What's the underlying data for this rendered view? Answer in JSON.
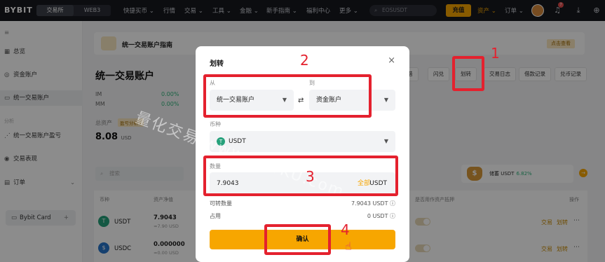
{
  "topbar": {
    "logo": "BYBIT",
    "segments": [
      "交易所",
      "WEB3"
    ],
    "nav": [
      "快捷买币 ⌄",
      "行情",
      "交易 ⌄",
      "工具 ⌄",
      "金融 ⌄",
      "新手指南 ⌄",
      "福利中心",
      "更多 ⌄"
    ],
    "search_text": "EOSUSDT",
    "deposit_label": "充值",
    "assets_label": "资产 ⌄",
    "orders_label": "订单 ⌄",
    "notification_count": "7"
  },
  "sidebar": {
    "items": [
      {
        "label": "总览",
        "icon": "grid-icon"
      },
      {
        "label": "资金账户",
        "icon": "wallet-icon"
      },
      {
        "label": "统一交易账户",
        "icon": "account-icon"
      },
      {
        "label": "统一交易账户盈亏",
        "icon": "chart-icon"
      },
      {
        "label": "交易表现",
        "icon": "performance-icon"
      },
      {
        "label": "订单",
        "icon": "orders-icon",
        "suffix": "⌄"
      }
    ],
    "section_label": "分析",
    "card_label": "Bybit Card",
    "card_suffix": "+"
  },
  "main": {
    "banner_title": "统一交易账户指南",
    "banner_button": "点击查看",
    "account_title": "统一交易账户",
    "stats": [
      {
        "label": "IM",
        "value": "0.00%"
      },
      {
        "label": "MM",
        "value": "0.00%"
      }
    ],
    "total_label": "总资产",
    "pnl_tag": "盈亏分析 ›",
    "total_value": "8.08",
    "total_unit": "USD",
    "buttons": [
      "借",
      "闪兑",
      "划转",
      "交易日志",
      "借款记录",
      "兑币记录"
    ],
    "search_placeholder": "搜索",
    "savings_text": "储蓄 USDT",
    "savings_pct": "6.82%",
    "table_headers": [
      "币种",
      "资产净值",
      "是否用作资产抵押",
      "操作"
    ],
    "rows": [
      {
        "coin": "USDT",
        "value": "7.9043",
        "sub": "≈7.90 USD",
        "actions": [
          "交易",
          "划转"
        ]
      },
      {
        "coin": "USDC",
        "value": "0.000000",
        "sub": "≈0.00 USD",
        "actions": [
          "交易",
          "划转"
        ]
      }
    ]
  },
  "modal": {
    "title": "划转",
    "from_label": "从",
    "from_value": "统一交易账户",
    "to_label": "到",
    "to_value": "资金账户",
    "coin_label": "币种",
    "coin_value": "USDT",
    "amount_label": "数量",
    "amount_value": "7.9043",
    "amount_all": "全部",
    "amount_unit": "USDT",
    "transferable_label": "可转数量",
    "transferable_value": "7.9043 USDT ⓘ",
    "used_label": "占用",
    "used_value": "0 USDT ⓘ",
    "confirm_label": "确认"
  },
  "annotations": {
    "steps": [
      "1",
      "2",
      "3",
      "4"
    ],
    "watermark": "量化交易 www.115KU.com",
    "box_color": "#e4212e"
  }
}
